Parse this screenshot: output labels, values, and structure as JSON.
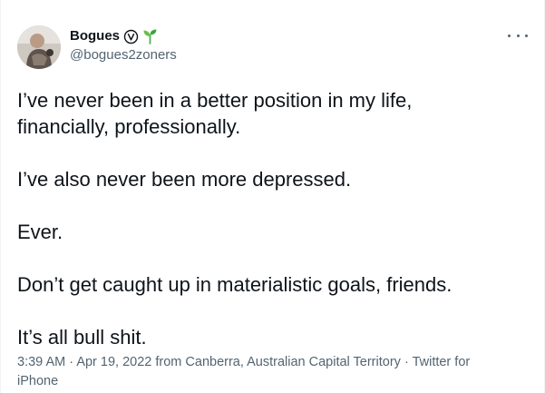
{
  "author": {
    "display_name": "Bogues",
    "handle": "@bogues2zoners",
    "avatar_icon": "avatar-photo",
    "badge_icon": "circled-v-icon",
    "emoji_icon": "seedling-icon"
  },
  "more_icon": "more-horizontal-icon",
  "tweet": {
    "paragraphs": [
      "I’ve never been in a better position in my life,\nfinancially, professionally.",
      "I’ve also never been more depressed.",
      "Ever.",
      "Don’t get caught up in materialistic goals, friends.",
      "It’s all bull shit."
    ]
  },
  "meta": {
    "time": "3:39 AM",
    "date": "Apr 19, 2022",
    "from_prefix": "from",
    "location": "Canberra, Australian Capital Territory",
    "separator": "·",
    "source": "Twitter for iPhone"
  },
  "colors": {
    "text": "#0f1419",
    "secondary": "#536471",
    "sprout": "#4caf50"
  }
}
